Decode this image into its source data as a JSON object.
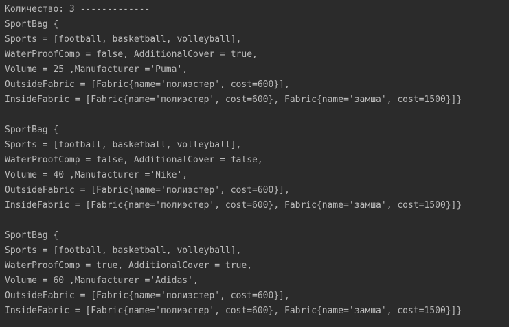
{
  "console": {
    "header": "Количество: 3 -------------",
    "bags": [
      {
        "open": "SportBag {",
        "sports": "Sports = [football, basketball, volleyball],",
        "flags": "WaterProofComp = false, AdditionalCover = true,",
        "volume": "Volume = 25 ,Manufacturer ='Puma',",
        "outside": "OutsideFabric = [Fabric{name='полиэстер', cost=600}],",
        "inside": "InsideFabric = [Fabric{name='полиэстер', cost=600}, Fabric{name='замша', cost=1500}]}"
      },
      {
        "open": "SportBag {",
        "sports": "Sports = [football, basketball, volleyball],",
        "flags": "WaterProofComp = false, AdditionalCover = false,",
        "volume": "Volume = 40 ,Manufacturer ='Nike',",
        "outside": "OutsideFabric = [Fabric{name='полиэстер', cost=600}],",
        "inside": "InsideFabric = [Fabric{name='полиэстер', cost=600}, Fabric{name='замша', cost=1500}]}"
      },
      {
        "open": "SportBag {",
        "sports": "Sports = [football, basketball, volleyball],",
        "flags": "WaterProofComp = true, AdditionalCover = true,",
        "volume": "Volume = 60 ,Manufacturer ='Adidas',",
        "outside": "OutsideFabric = [Fabric{name='полиэстер', cost=600}],",
        "inside": "InsideFabric = [Fabric{name='полиэстер', cost=600}, Fabric{name='замша', cost=1500}]}"
      }
    ],
    "colors": {
      "background": "#2b2b2b",
      "text": "#bbbbbb"
    }
  }
}
